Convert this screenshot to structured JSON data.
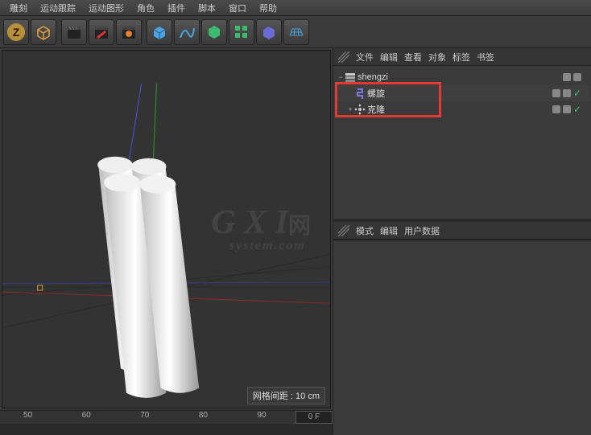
{
  "menu": {
    "items": [
      "雕刻",
      "运动跟踪",
      "运动图形",
      "角色",
      "插件",
      "脚本",
      "窗口",
      "帮助"
    ]
  },
  "toolbar": {
    "groups": [
      [
        "gold-z",
        "cube-wire"
      ],
      [
        "clapper-dark",
        "clapper-red",
        "clapper-orange"
      ],
      [
        "cube-solid",
        "spline",
        "effector",
        "array",
        "sphere",
        "floor"
      ]
    ]
  },
  "viewport": {
    "grid_label": "网格间距 : 10 cm"
  },
  "timeline": {
    "ticks": [
      "50",
      "60",
      "70",
      "80",
      "90"
    ],
    "frame_label": "0 F"
  },
  "objpanel": {
    "tabs": [
      "文件",
      "编辑",
      "查看",
      "对象",
      "标签",
      "书签"
    ]
  },
  "tree": [
    {
      "exp": "−",
      "icon": "layer",
      "name": "shengzi",
      "dots": [
        "gray",
        "gray"
      ],
      "check": false,
      "indent": 0
    },
    {
      "exp": "",
      "icon": "helix",
      "name": "螺旋",
      "dots": [
        "gray",
        "gray"
      ],
      "check": true,
      "indent": 1
    },
    {
      "exp": "+",
      "icon": "cloner",
      "name": "克隆",
      "dots": [
        "gray",
        "gray"
      ],
      "check": true,
      "indent": 1
    }
  ],
  "attrpanel": {
    "tabs": [
      "模式",
      "编辑",
      "用户数据"
    ]
  },
  "watermark": {
    "big": "G X I",
    "small": "system.com",
    "hanzi": "网"
  }
}
